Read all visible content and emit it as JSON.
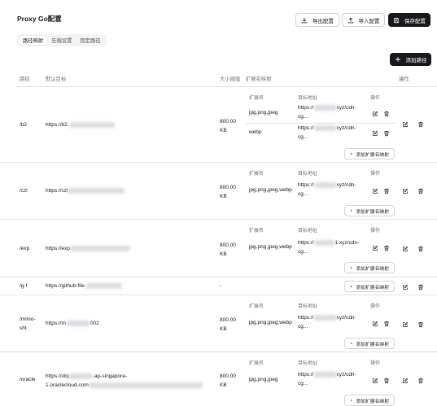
{
  "header": {
    "title": "Proxy Go配置",
    "export_label": "导出配置",
    "import_label": "导入配置",
    "save_label": "保存配置"
  },
  "tabs": [
    {
      "label": "路径映射",
      "active": true
    },
    {
      "label": "压缩设置",
      "active": false
    },
    {
      "label": "固定路径",
      "active": false
    }
  ],
  "add_path_label": "添加路径",
  "columns": {
    "path": "路径",
    "default_target": "默认目标",
    "size_threshold": "大小阈值",
    "ext_map": "扩展名映射",
    "actions": "操作"
  },
  "sub_columns": {
    "ext": "扩展名",
    "target": "目标地址",
    "actions": "操作"
  },
  "add_ext_label": "添加扩展名映射",
  "rows": [
    {
      "path": "/b2",
      "target": "https://b2.",
      "size": "800.00",
      "unit": "KB",
      "mappings": [
        {
          "ext": "jpg,png,jpeg",
          "target_prefix": "https://",
          "target_suffix": "xyz/cdn-",
          "target_line2": "cg..."
        },
        {
          "ext": "webp",
          "target_prefix": "https://",
          "target_suffix": "xyz/cdn-",
          "target_line2": "cg..."
        }
      ]
    },
    {
      "path": "/czl",
      "target": "https://czl",
      "size": "800.00",
      "unit": "KB",
      "mappings": [
        {
          "ext": "jpg,png,jpeg,webp",
          "target_prefix": "https://",
          "target_suffix": "xyz/cdn-",
          "target_line2": "cg..."
        }
      ]
    },
    {
      "path": "/exp",
      "target": "https://exp",
      "size": "800.00",
      "unit": "KB",
      "mappings": [
        {
          "ext": "jpg,png,jpeg,webp",
          "target_prefix": "https://",
          "target_suffix": "1.xyz/cdn-",
          "target_line2": "cg..."
        }
      ]
    },
    {
      "path": "/g-f",
      "target": "https://github-file-",
      "size": "-",
      "unit": "",
      "mappings": []
    },
    {
      "path_line1": "/minio-",
      "path_line2": "sht",
      "target": "https://m",
      "target_suffix": "002",
      "size": "800.00",
      "unit": "KB",
      "mappings": [
        {
          "ext": "jpg,png,jpeg,webp",
          "target_prefix": "https://",
          "target_suffix": "xyz/cdn-",
          "target_line2": "cg..."
        }
      ]
    },
    {
      "path": "/oracle",
      "target": "https://obj",
      "target_mid": ".ap-singapore-",
      "target_line2": "1.oraclecloud.com",
      "size": "800.00",
      "unit": "KB",
      "mappings": [
        {
          "ext": "jpg,png,jpeg",
          "target_prefix": "https://",
          "target_suffix": "xyz/cdn-",
          "target_line2": "cg..."
        }
      ]
    }
  ]
}
